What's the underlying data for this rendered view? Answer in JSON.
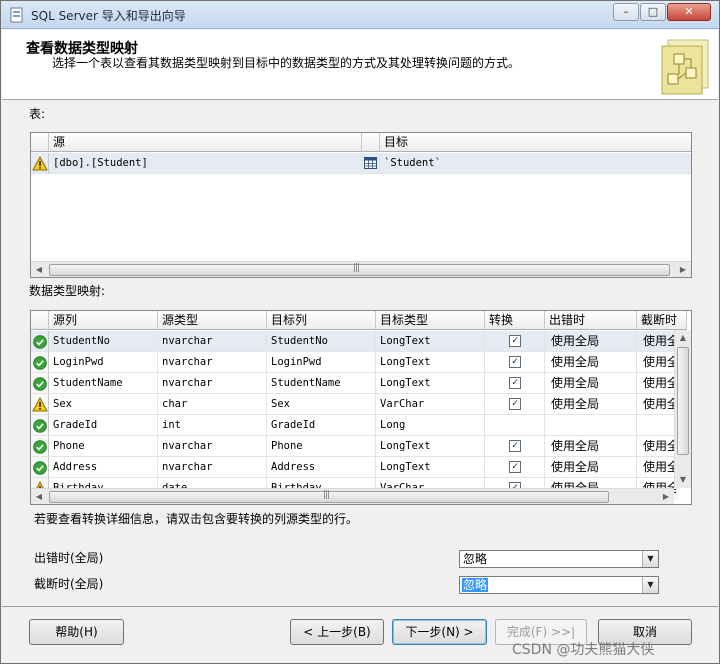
{
  "window": {
    "title": "SQL Server 导入和导出向导",
    "controls": {
      "minimize": "–",
      "maximize": "□",
      "close": "✕"
    }
  },
  "header": {
    "title": "查看数据类型映射",
    "subtitle": "选择一个表以查看其数据类型映射到目标中的数据类型的方式及其处理转换问题的方式。"
  },
  "tables_section": {
    "label": "表:",
    "columns": [
      "源",
      "目标"
    ],
    "rows": [
      {
        "status": "warning",
        "source": "[dbo].[Student]",
        "target_icon": "table-icon",
        "target": "`Student`"
      }
    ]
  },
  "mapping_section": {
    "label": "数据类型映射:",
    "columns": [
      "源列",
      "源类型",
      "目标列",
      "目标类型",
      "转换",
      "出错时",
      "截断时"
    ],
    "rows": [
      {
        "status": "ok",
        "source_column": "StudentNo",
        "source_type": "nvarchar",
        "target_column": "StudentNo",
        "target_type": "LongText",
        "convert": true,
        "on_error": "使用全局",
        "on_truncate": "使用全"
      },
      {
        "status": "ok",
        "source_column": "LoginPwd",
        "source_type": "nvarchar",
        "target_column": "LoginPwd",
        "target_type": "LongText",
        "convert": true,
        "on_error": "使用全局",
        "on_truncate": "使用全"
      },
      {
        "status": "ok",
        "source_column": "StudentName",
        "source_type": "nvarchar",
        "target_column": "StudentName",
        "target_type": "LongText",
        "convert": true,
        "on_error": "使用全局",
        "on_truncate": "使用全"
      },
      {
        "status": "warning",
        "source_column": "Sex",
        "source_type": "char",
        "target_column": "Sex",
        "target_type": "VarChar",
        "convert": true,
        "on_error": "使用全局",
        "on_truncate": "使用全"
      },
      {
        "status": "ok",
        "source_column": "GradeId",
        "source_type": "int",
        "target_column": "GradeId",
        "target_type": "Long",
        "convert": false,
        "on_error": "",
        "on_truncate": ""
      },
      {
        "status": "ok",
        "source_column": "Phone",
        "source_type": "nvarchar",
        "target_column": "Phone",
        "target_type": "LongText",
        "convert": true,
        "on_error": "使用全局",
        "on_truncate": "使用全"
      },
      {
        "status": "ok",
        "source_column": "Address",
        "source_type": "nvarchar",
        "target_column": "Address",
        "target_type": "LongText",
        "convert": true,
        "on_error": "使用全局",
        "on_truncate": "使用全"
      },
      {
        "status": "warning",
        "source_column": "Birthday",
        "source_type": "date",
        "target_column": "Birthday",
        "target_type": "VarChar",
        "convert": true,
        "on_error": "使用全局",
        "on_truncate": "使用全"
      }
    ],
    "hint": "若要查看转换详细信息，请双击包含要转换的列源类型的行。"
  },
  "global_settings": {
    "on_error_label": "出错时(全局)",
    "on_error_value": "忽略",
    "on_truncate_label": "截断时(全局)",
    "on_truncate_value": "忽略"
  },
  "buttons": {
    "help": "帮助(H)",
    "back": "< 上一步(B)",
    "next": "下一步(N) >",
    "finish": "完成(F) >>|",
    "cancel": "取消"
  },
  "watermark": "CSDN @功夫熊猫大侠",
  "colors": {
    "accent": "#3399ff",
    "selected_row": "#e6eaf2",
    "ok": "#3aa53a",
    "warning": "#f2c200"
  }
}
